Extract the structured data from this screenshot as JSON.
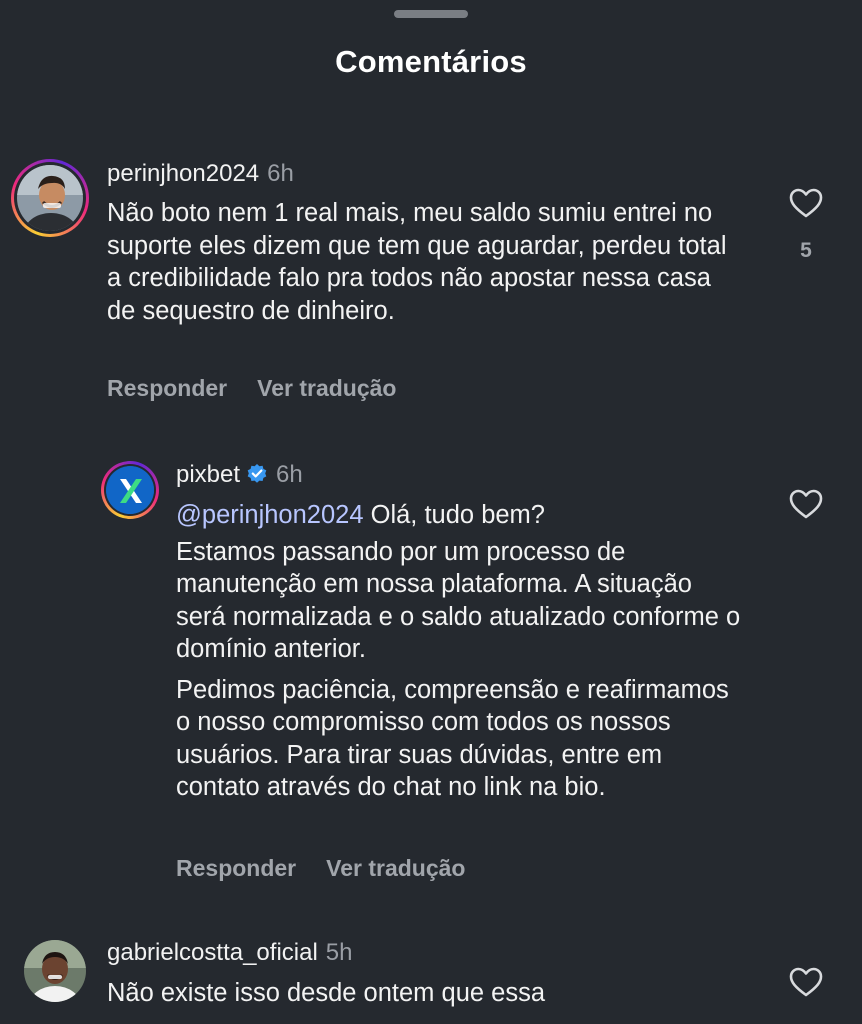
{
  "header": {
    "title": "Comentários"
  },
  "comments": [
    {
      "username": "perinjhon2024",
      "time": "6h",
      "text": "Não boto nem 1 real mais, meu saldo sumiu entrei no suporte eles dizem que tem que aguardar, perdeu total a credibilidade falo pra todos não apostar nessa casa de sequestro de dinheiro.",
      "likes": "5",
      "reply_label": "Responder",
      "translate_label": "Ver tradução"
    },
    {
      "username": "pixbet",
      "time": "6h",
      "verified": true,
      "mention": "@perinjhon2024",
      "text_first": "Olá, tudo bem?",
      "text_p1": "Estamos passando por um processo de manutenção em nossa plataforma. A situação será normalizada e o saldo atualizado conforme o domínio anterior.",
      "text_p2": "Pedimos paciência, compreensão e reafirmamos o nosso compromisso com todos os nossos usuários. Para tirar suas dúvidas, entre em contato através do chat no link na bio.",
      "reply_label": "Responder",
      "translate_label": "Ver tradução"
    },
    {
      "username": "gabrielcostta_oficial",
      "time": "5h",
      "text": "Não existe isso desde ontem que essa"
    }
  ],
  "icons": {
    "like": "heart-outline-icon",
    "verified": "verified-badge-icon"
  },
  "colors": {
    "background": "#25292f",
    "verified": "#3897f0",
    "mention": "#b8c6ff",
    "muted": "#9a9ea5"
  }
}
